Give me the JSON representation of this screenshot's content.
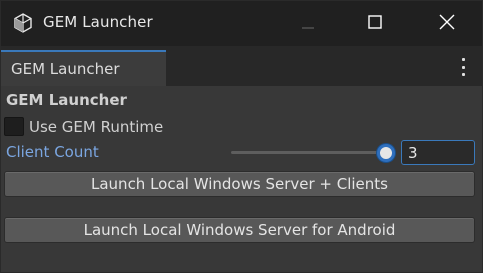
{
  "window": {
    "title": "GEM Launcher"
  },
  "tab": {
    "label": "GEM Launcher"
  },
  "panel": {
    "section_title": "GEM Launcher",
    "use_runtime": {
      "label": "Use GEM Runtime",
      "checked": false
    },
    "client_count": {
      "label": "Client Count",
      "value": "3"
    },
    "buttons": {
      "launch_clients": "Launch Local Windows Server + Clients",
      "launch_android": "Launch Local Windows Server for Android"
    }
  },
  "colors": {
    "accent": "#3a79bb",
    "label_blue": "#7ba6e1",
    "background": "#383838",
    "titlebar": "#202020"
  },
  "icons": {
    "app": "unity-cube-icon",
    "minimize": "minimize-icon",
    "maximize": "maximize-icon",
    "close": "close-icon",
    "menu": "kebab-menu-icon"
  }
}
